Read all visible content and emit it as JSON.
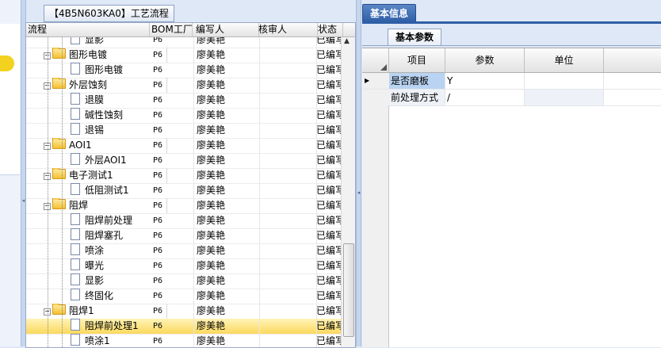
{
  "flow_panel": {
    "caption": "【4B5N603KA0】工艺流程",
    "headers": {
      "name": "流程",
      "bom": "BOM工厂",
      "writer": "编写人",
      "reviewer": "核审人",
      "status": "状态"
    },
    "rows": [
      {
        "level": 2,
        "type": "doc",
        "name": "显影",
        "bom": "P6",
        "writer": "廖美艳",
        "reviewer": "",
        "status": "已编写"
      },
      {
        "level": 1,
        "type": "folder",
        "name": "图形电镀",
        "bom": "P6",
        "writer": "廖美艳",
        "reviewer": "",
        "status": "已编写"
      },
      {
        "level": 2,
        "type": "doc",
        "name": "图形电镀",
        "bom": "P6",
        "writer": "廖美艳",
        "reviewer": "",
        "status": "已编写"
      },
      {
        "level": 1,
        "type": "folder",
        "name": "外层蚀刻",
        "bom": "P6",
        "writer": "廖美艳",
        "reviewer": "",
        "status": "已编写"
      },
      {
        "level": 2,
        "type": "doc",
        "name": "退膜",
        "bom": "P6",
        "writer": "廖美艳",
        "reviewer": "",
        "status": "已编写"
      },
      {
        "level": 2,
        "type": "doc",
        "name": "碱性蚀刻",
        "bom": "P6",
        "writer": "廖美艳",
        "reviewer": "",
        "status": "已编写"
      },
      {
        "level": 2,
        "type": "doc",
        "name": "退锡",
        "bom": "P6",
        "writer": "廖美艳",
        "reviewer": "",
        "status": "已编写"
      },
      {
        "level": 1,
        "type": "folder",
        "name": "AOI1",
        "bom": "P6",
        "writer": "廖美艳",
        "reviewer": "",
        "status": "已编写"
      },
      {
        "level": 2,
        "type": "doc",
        "name": "外层AOI1",
        "bom": "P6",
        "writer": "廖美艳",
        "reviewer": "",
        "status": "已编写"
      },
      {
        "level": 1,
        "type": "folder",
        "name": "电子测试1",
        "bom": "P6",
        "writer": "廖美艳",
        "reviewer": "",
        "status": "已编写"
      },
      {
        "level": 2,
        "type": "doc",
        "name": "低阻测试1",
        "bom": "P6",
        "writer": "廖美艳",
        "reviewer": "",
        "status": "已编写"
      },
      {
        "level": 1,
        "type": "folder",
        "name": "阻焊",
        "bom": "P6",
        "writer": "廖美艳",
        "reviewer": "",
        "status": "已编写"
      },
      {
        "level": 2,
        "type": "doc",
        "name": "阻焊前处理",
        "bom": "P6",
        "writer": "廖美艳",
        "reviewer": "",
        "status": "已编写"
      },
      {
        "level": 2,
        "type": "doc",
        "name": "阻焊塞孔",
        "bom": "P6",
        "writer": "廖美艳",
        "reviewer": "",
        "status": "已编写"
      },
      {
        "level": 2,
        "type": "doc",
        "name": "喷涂",
        "bom": "P6",
        "writer": "廖美艳",
        "reviewer": "",
        "status": "已编写"
      },
      {
        "level": 2,
        "type": "doc",
        "name": "曝光",
        "bom": "P6",
        "writer": "廖美艳",
        "reviewer": "",
        "status": "已编写"
      },
      {
        "level": 2,
        "type": "doc",
        "name": "显影",
        "bom": "P6",
        "writer": "廖美艳",
        "reviewer": "",
        "status": "已编写"
      },
      {
        "level": 2,
        "type": "doc",
        "name": "终固化",
        "bom": "P6",
        "writer": "廖美艳",
        "reviewer": "",
        "status": "已编写"
      },
      {
        "level": 1,
        "type": "folder",
        "name": "阻焊1",
        "bom": "P6",
        "writer": "廖美艳",
        "reviewer": "",
        "status": "已编写"
      },
      {
        "level": 2,
        "type": "doc",
        "name": "阻焊前处理1",
        "bom": "P6",
        "writer": "廖美艳",
        "reviewer": "",
        "status": "已编写",
        "selected": true
      },
      {
        "level": 2,
        "type": "doc",
        "name": "喷涂1",
        "bom": "P6",
        "writer": "廖美艳",
        "reviewer": "",
        "status": "已编写"
      }
    ]
  },
  "right_panel": {
    "tab_label": "基本信息",
    "subtab_label": "基本参数",
    "headers": {
      "item": "项目",
      "param": "参数",
      "unit": "单位"
    },
    "rows": [
      {
        "item": "是否磨板",
        "param": "Y",
        "unit": "",
        "current": true
      },
      {
        "item": "前处理方式",
        "param": "/",
        "unit": ""
      }
    ]
  },
  "colors": {
    "tab_blue": "#2e5ea6",
    "selection_yellow": "#fbd95e",
    "folder_yellow": "#f4c030"
  }
}
